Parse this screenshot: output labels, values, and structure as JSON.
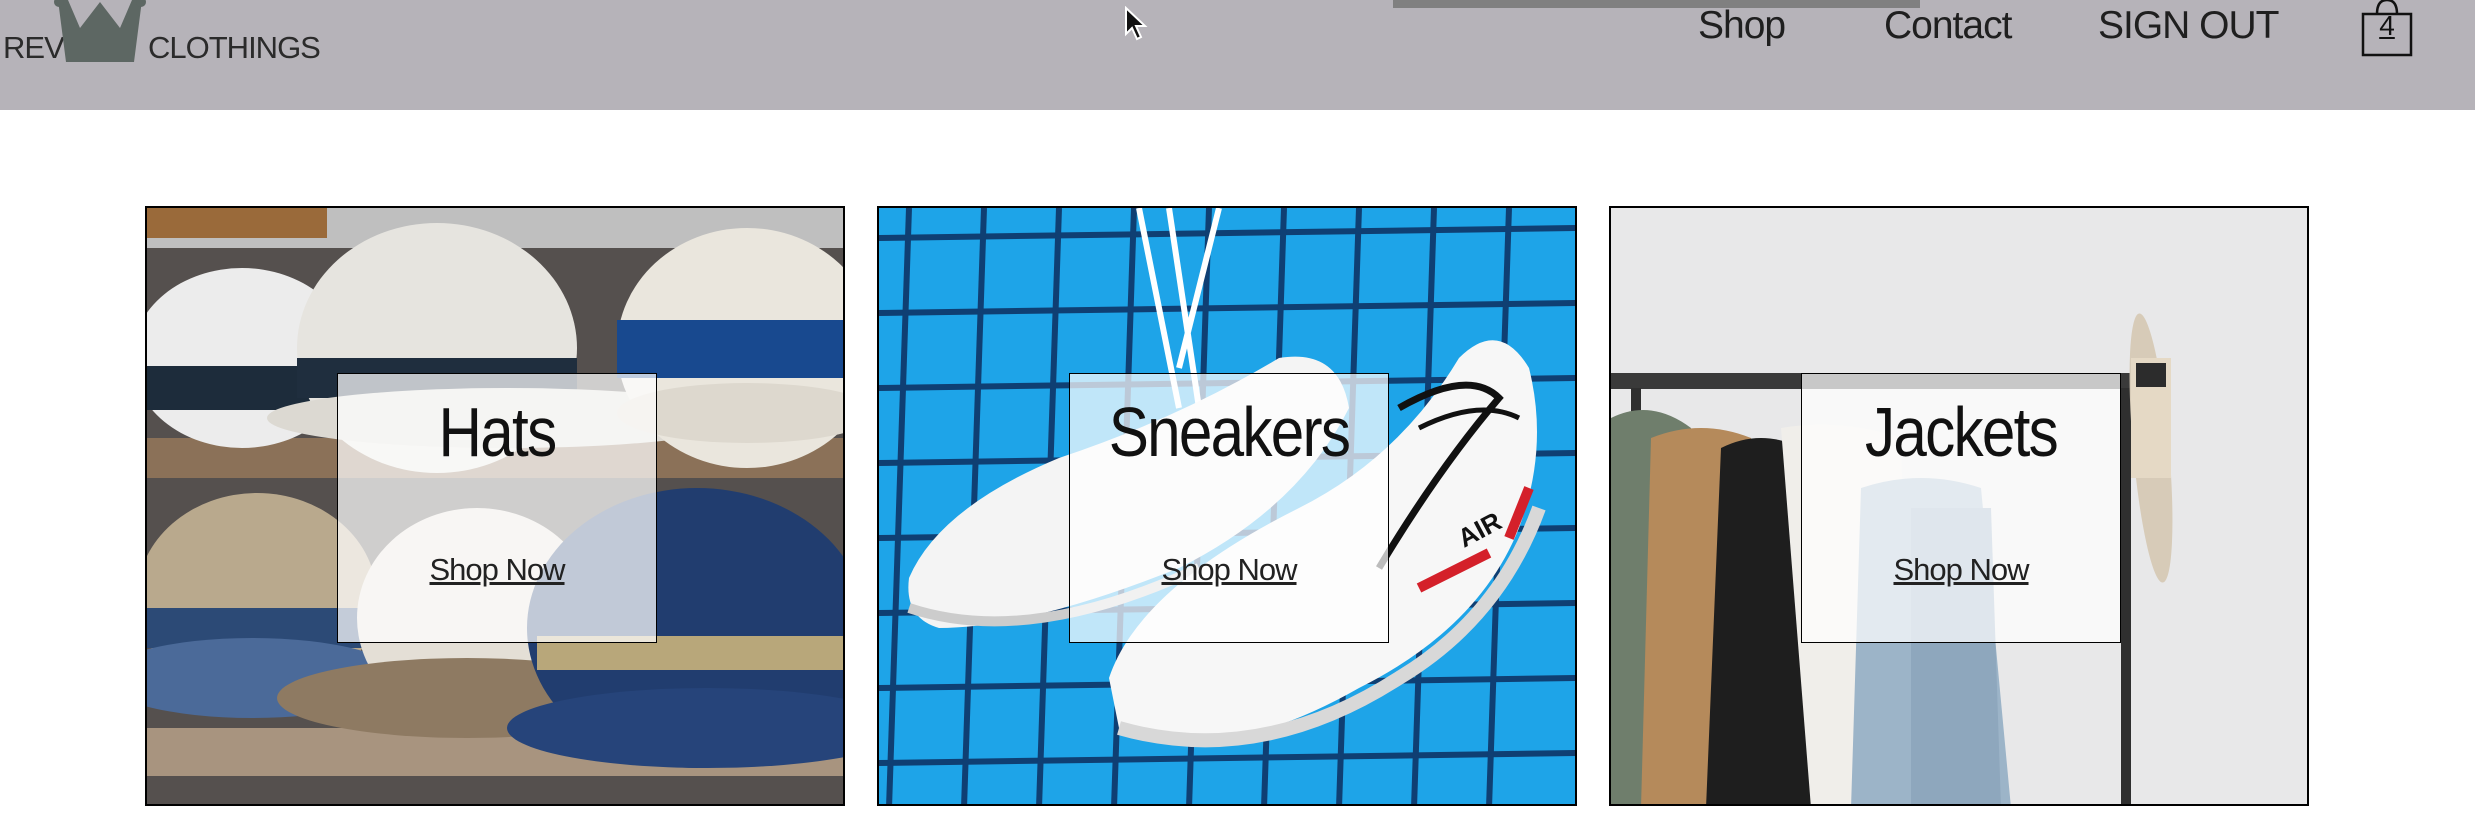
{
  "header": {
    "brand_left": "REV",
    "brand_right": "CLOTHINGS",
    "nav": {
      "shop": "Shop",
      "contact": "Contact",
      "sign_out": "SIGN OUT"
    },
    "cart_count": "4"
  },
  "categories": [
    {
      "title": "Hats",
      "cta": "Shop Now"
    },
    {
      "title": "Sneakers",
      "cta": "Shop Now"
    },
    {
      "title": "Jackets",
      "cta": "Shop Now"
    }
  ],
  "colors": {
    "header_bg": "#b6b3b9",
    "accent_bar": "#808080",
    "page_bg": "#ffffff"
  }
}
